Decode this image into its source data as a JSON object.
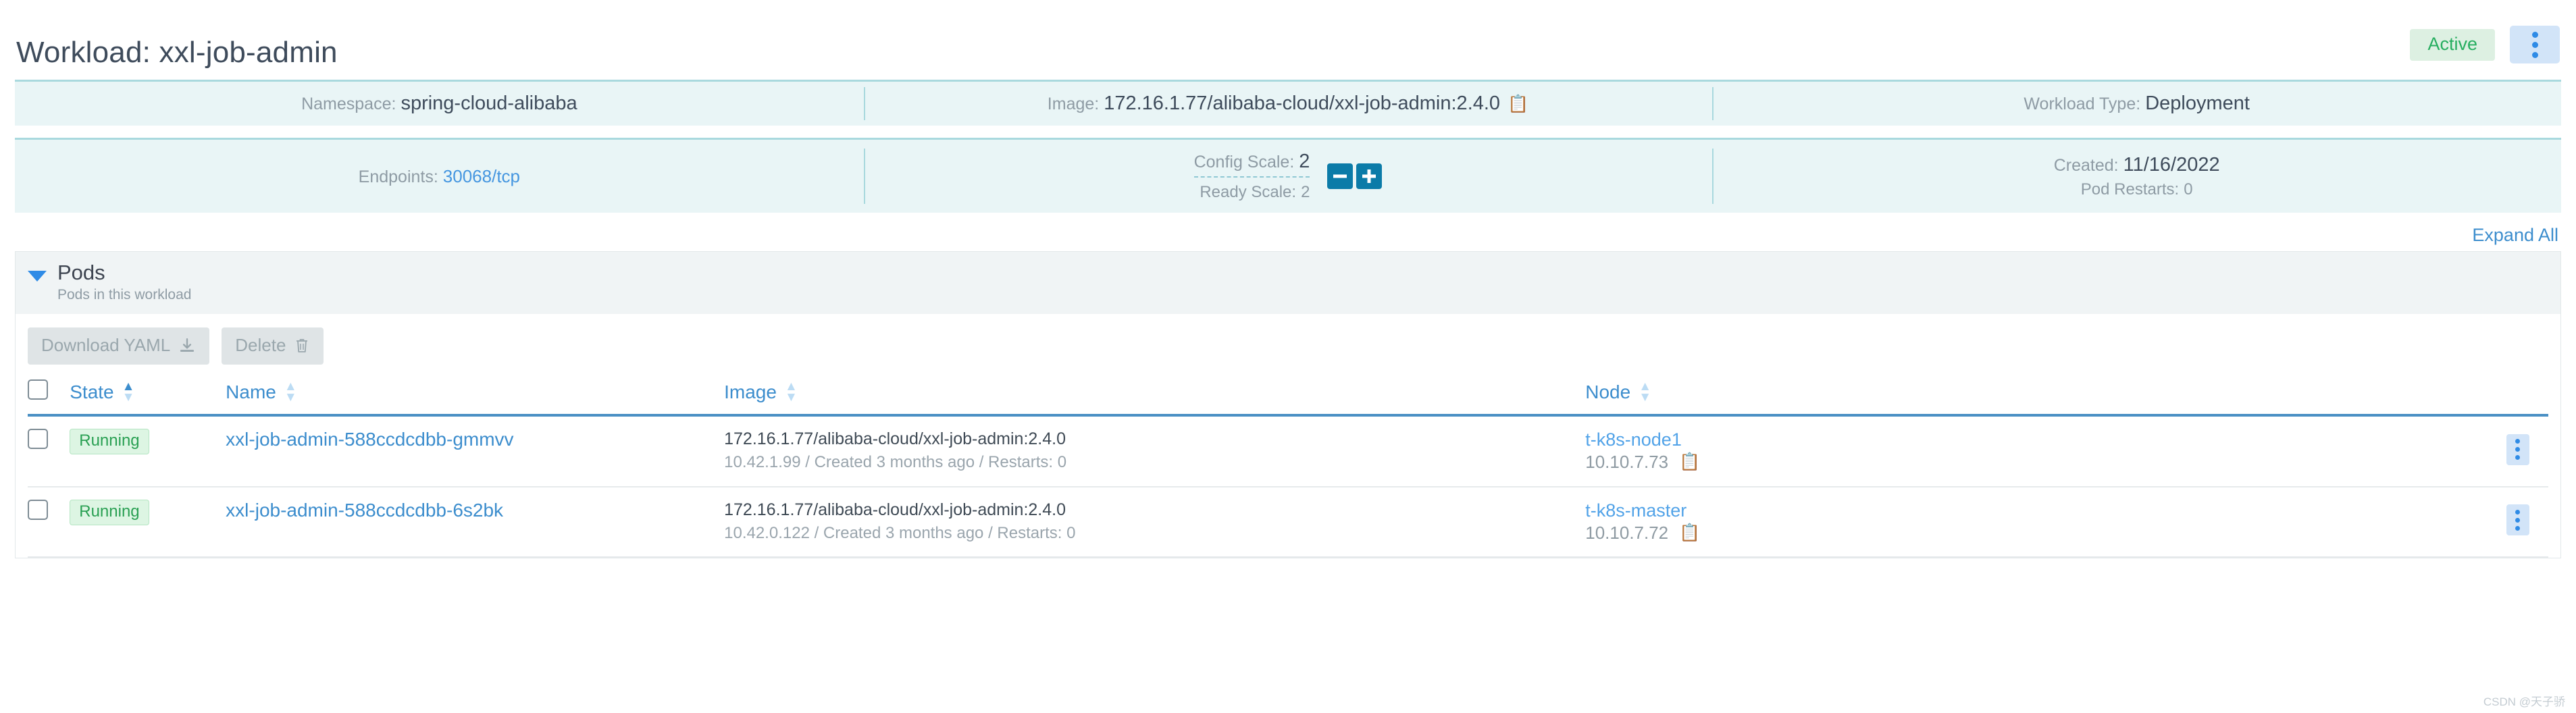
{
  "header": {
    "title": "Workload: xxl-job-admin",
    "state_badge": "Active",
    "kebab_icon": "kebab-vertical-icon"
  },
  "info_row_1": [
    {
      "label": "Namespace:",
      "value": "spring-cloud-alibaba"
    },
    {
      "label": "Image:",
      "value": "172.16.1.77/alibaba-cloud/xxl-job-admin:2.4.0",
      "copy_icon": "copy-icon"
    },
    {
      "label": "Workload Type:",
      "value": "Deployment"
    }
  ],
  "info_row_2": {
    "endpoints": {
      "label": "Endpoints:",
      "value": "30068/tcp"
    },
    "scale": {
      "config_label": "Config Scale:",
      "config_value": "2",
      "ready_label": "Ready Scale:",
      "ready_value": "2",
      "decrease_icon": "minus-icon",
      "increase_icon": "plus-icon"
    },
    "created": {
      "label": "Created:",
      "value": "11/16/2022",
      "restarts_label": "Pod Restarts:",
      "restarts_value": "0"
    }
  },
  "expand_all": "Expand All",
  "pods_panel": {
    "caret_icon": "caret-down-icon",
    "title": "Pods",
    "subtitle": "Pods in this workload",
    "toolbar": {
      "download_yaml": "Download YAML",
      "download_icon": "download-icon",
      "delete": "Delete",
      "delete_icon": "trash-icon"
    },
    "columns": [
      {
        "label": "State",
        "sort": "asc"
      },
      {
        "label": "Name",
        "sort": "none"
      },
      {
        "label": "Image",
        "sort": "none"
      },
      {
        "label": "Node",
        "sort": "none"
      }
    ],
    "rows": [
      {
        "state": "Running",
        "name": "xxl-job-admin-588ccdcdbb-gmmvv",
        "image": "172.16.1.77/alibaba-cloud/xxl-job-admin:2.4.0",
        "image_sub": "10.42.1.99 / Created 3 months ago / Restarts: 0",
        "node": "t-k8s-node1",
        "node_ip": "10.10.7.73",
        "node_copy_icon": "copy-icon",
        "menu_icon": "kebab-vertical-icon"
      },
      {
        "state": "Running",
        "name": "xxl-job-admin-588ccdcdbb-6s2bk",
        "image": "172.16.1.77/alibaba-cloud/xxl-job-admin:2.4.0",
        "image_sub": "10.42.0.122 / Created 3 months ago / Restarts: 0",
        "node": "t-k8s-master",
        "node_ip": "10.10.7.72",
        "node_copy_icon": "copy-icon",
        "menu_icon": "kebab-vertical-icon"
      }
    ]
  },
  "watermark": "CSDN @天子骄",
  "colors": {
    "accent_blue": "#3c8dcd",
    "badge_green_bg": "#ddf0e2",
    "badge_green_text": "#27ae60",
    "banner_bg": "#e9f5f6",
    "banner_border": "#a9d9de",
    "stepper_blue": "#0b7ba8"
  }
}
